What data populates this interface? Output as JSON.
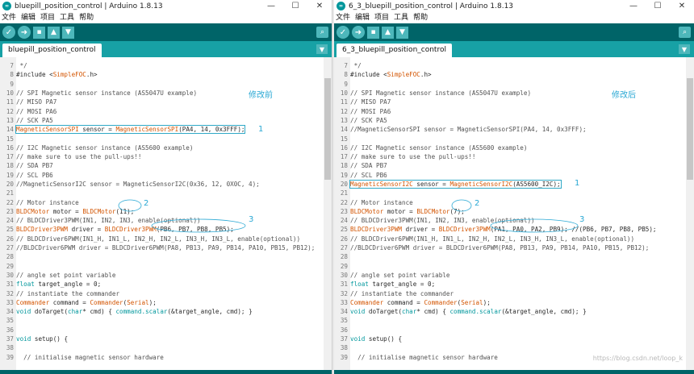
{
  "app_icon_glyph": "∞",
  "window_controls": [
    "—",
    "☐",
    "✕"
  ],
  "toolbar_icons": [
    "verify-icon",
    "upload-icon",
    "new-icon",
    "open-icon",
    "save-icon",
    "serial-monitor-icon"
  ],
  "colors": {
    "toolbar": "#006468",
    "tabbar": "#17a1a5",
    "button": "#4db7bb",
    "annotation": "#2aa8d4",
    "type": "#d35400",
    "keyword": "#00979c"
  },
  "left": {
    "title": "bluepill_position_control | Arduino 1.8.13",
    "menu": [
      "文件",
      "编辑",
      "项目",
      "工具",
      "帮助"
    ],
    "tab": "bluepill_position_control",
    "note": "修改前",
    "lines": [
      {
        "n": "7",
        "t": " */"
      },
      {
        "n": "8",
        "t": "#include <SimpleFOC.h>"
      },
      {
        "n": "9",
        "t": ""
      },
      {
        "n": "10",
        "t": "// SPI Magnetic sensor instance (AS5047U example)"
      },
      {
        "n": "11",
        "t": "// MISO PA7"
      },
      {
        "n": "12",
        "t": "// MOSI PA6"
      },
      {
        "n": "13",
        "t": "// SCK PA5"
      },
      {
        "n": "14",
        "t": "MagneticSensorSPI sensor = MagneticSensorSPI(PA4, 14, 0x3FFF);"
      },
      {
        "n": "15",
        "t": ""
      },
      {
        "n": "16",
        "t": "// I2C Magnetic sensor instance (AS5600 example)"
      },
      {
        "n": "17",
        "t": "// make sure to use the pull-ups!!"
      },
      {
        "n": "18",
        "t": "// SDA PB7"
      },
      {
        "n": "19",
        "t": "// SCL PB6"
      },
      {
        "n": "20",
        "t": "//MagneticSensorI2C sensor = MagneticSensorI2C(0x36, 12, 0X0C, 4);"
      },
      {
        "n": "21",
        "t": ""
      },
      {
        "n": "22",
        "t": "// Motor instance"
      },
      {
        "n": "23",
        "t": "BLDCMotor motor = BLDCMotor(11);"
      },
      {
        "n": "24",
        "t": "// BLDCDriver3PWM(IN1, IN2, IN3, enable(optional))"
      },
      {
        "n": "25",
        "t": "BLDCDriver3PWM driver = BLDCDriver3PWM(PB6, PB7, PB8, PB5);"
      },
      {
        "n": "26",
        "t": "// BLDCDriver6PWM(IN1_H, IN1_L, IN2_H, IN2_L, IN3_H, IN3_L, enable(optional))"
      },
      {
        "n": "27",
        "t": "//BLDCDriver6PWM driver = BLDCDriver6PWM(PA8, PB13, PA9, PB14, PA10, PB15, PB12);"
      },
      {
        "n": "28",
        "t": ""
      },
      {
        "n": "29",
        "t": ""
      },
      {
        "n": "30",
        "t": "// angle set point variable"
      },
      {
        "n": "31",
        "t": "float target_angle = 0;"
      },
      {
        "n": "32",
        "t": "// instantiate the commander"
      },
      {
        "n": "33",
        "t": "Commander command = Commander(Serial);"
      },
      {
        "n": "34",
        "t": "void doTarget(char* cmd) { command.scalar(&target_angle, cmd); }"
      },
      {
        "n": "35",
        "t": ""
      },
      {
        "n": "36",
        "t": ""
      },
      {
        "n": "37",
        "t": "void setup() {"
      },
      {
        "n": "38",
        "t": ""
      },
      {
        "n": "39",
        "t": "  // initialise magnetic sensor hardware"
      }
    ],
    "markers": [
      "1",
      "2",
      "3"
    ]
  },
  "right": {
    "title": "6_3_bluepill_position_control | Arduino 1.8.13",
    "menu": [
      "文件",
      "编辑",
      "项目",
      "工具",
      "帮助"
    ],
    "tab": "6_3_bluepill_position_control",
    "note": "修改后",
    "lines": [
      {
        "n": "7",
        "t": " */"
      },
      {
        "n": "8",
        "t": "#include <SimpleFOC.h>"
      },
      {
        "n": "9",
        "t": ""
      },
      {
        "n": "10",
        "t": "// SPI Magnetic sensor instance (AS5047U example)"
      },
      {
        "n": "11",
        "t": "// MISO PA7"
      },
      {
        "n": "12",
        "t": "// MOSI PA6"
      },
      {
        "n": "13",
        "t": "// SCK PA5"
      },
      {
        "n": "14",
        "t": "//MagneticSensorSPI sensor = MagneticSensorSPI(PA4, 14, 0x3FFF);"
      },
      {
        "n": "15",
        "t": ""
      },
      {
        "n": "16",
        "t": "// I2C Magnetic sensor instance (AS5600 example)"
      },
      {
        "n": "17",
        "t": "// make sure to use the pull-ups!!"
      },
      {
        "n": "18",
        "t": "// SDA PB7"
      },
      {
        "n": "19",
        "t": "// SCL PB6"
      },
      {
        "n": "20",
        "t": "MagneticSensorI2C sensor = MagneticSensorI2C(AS5600_I2C);"
      },
      {
        "n": "21",
        "t": ""
      },
      {
        "n": "22",
        "t": "// Motor instance"
      },
      {
        "n": "23",
        "t": "BLDCMotor motor = BLDCMotor(7);"
      },
      {
        "n": "24",
        "t": "// BLDCDriver3PWM(IN1, IN2, IN3, enable(optional))"
      },
      {
        "n": "25",
        "t": "BLDCDriver3PWM driver = BLDCDriver3PWM(PA1, PA0, PA2, PB9); //(PB6, PB7, PB8, PB5);"
      },
      {
        "n": "26",
        "t": "// BLDCDriver6PWM(IN1_H, IN1_L, IN2_H, IN2_L, IN3_H, IN3_L, enable(optional))"
      },
      {
        "n": "27",
        "t": "//BLDCDriver6PWM driver = BLDCDriver6PWM(PA8, PB13, PA9, PB14, PA10, PB15, PB12);"
      },
      {
        "n": "28",
        "t": ""
      },
      {
        "n": "29",
        "t": ""
      },
      {
        "n": "30",
        "t": "// angle set point variable"
      },
      {
        "n": "31",
        "t": "float target_angle = 0;"
      },
      {
        "n": "32",
        "t": "// instantiate the commander"
      },
      {
        "n": "33",
        "t": "Commander command = Commander(Serial);"
      },
      {
        "n": "34",
        "t": "void doTarget(char* cmd) { command.scalar(&target_angle, cmd); }"
      },
      {
        "n": "35",
        "t": ""
      },
      {
        "n": "36",
        "t": ""
      },
      {
        "n": "37",
        "t": "void setup() {"
      },
      {
        "n": "38",
        "t": ""
      },
      {
        "n": "39",
        "t": "  // initialise magnetic sensor hardware"
      }
    ],
    "markers": [
      "1",
      "2",
      "3"
    ]
  },
  "watermark": "https://blog.csdn.net/loop_k"
}
